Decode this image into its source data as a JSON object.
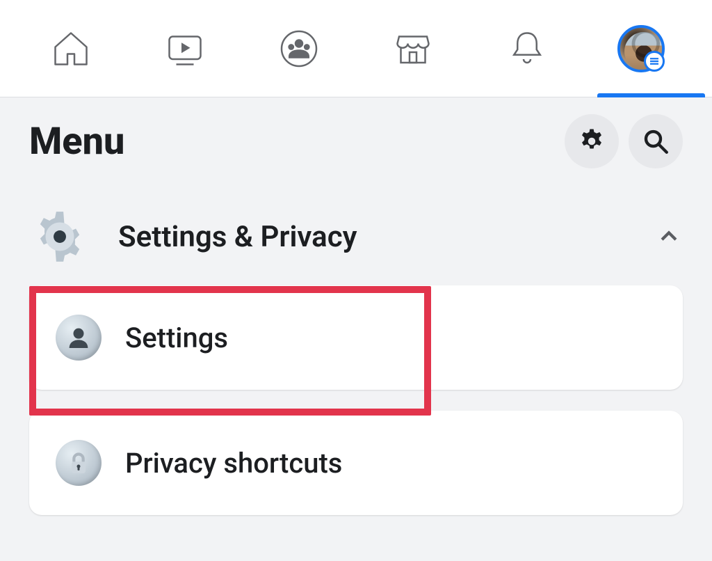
{
  "nav": {
    "active_tab": "menu",
    "items": [
      "home",
      "videos",
      "groups",
      "marketplace",
      "notifications",
      "menu"
    ]
  },
  "menu": {
    "title": "Menu",
    "action_buttons": {
      "settings_icon": "gear-icon",
      "search_icon": "search-icon"
    }
  },
  "section": {
    "icon": "gear-icon",
    "title": "Settings & Privacy",
    "expanded": true
  },
  "items": [
    {
      "icon": "person-icon",
      "label": "Settings",
      "highlighted": true
    },
    {
      "icon": "lock-icon",
      "label": "Privacy shortcuts",
      "highlighted": false
    }
  ],
  "colors": {
    "accent": "#1877f2",
    "highlight_border": "#e2344c",
    "page_bg": "#f2f3f5",
    "card_bg": "#ffffff"
  }
}
